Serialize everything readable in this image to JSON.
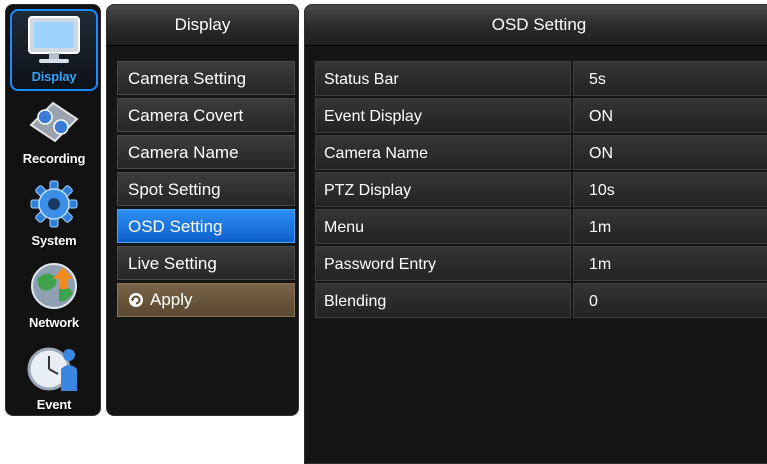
{
  "sidebar": {
    "items": [
      {
        "label": "Display",
        "icon": "monitor-icon",
        "active": true
      },
      {
        "label": "Recording",
        "icon": "film-reel-icon",
        "active": false
      },
      {
        "label": "System",
        "icon": "gear-icon",
        "active": false
      },
      {
        "label": "Network",
        "icon": "globe-icon",
        "active": false
      },
      {
        "label": "Event",
        "icon": "clock-person-icon",
        "active": false
      }
    ]
  },
  "menu": {
    "title": "Display",
    "items": [
      {
        "label": "Camera Setting"
      },
      {
        "label": "Camera Covert"
      },
      {
        "label": "Camera Name"
      },
      {
        "label": "Spot Setting"
      },
      {
        "label": "OSD Setting",
        "selected": true
      },
      {
        "label": "Live Setting"
      }
    ],
    "apply_label": "Apply",
    "apply_icon": "refresh-icon"
  },
  "panel": {
    "title": "OSD Setting",
    "rows": [
      {
        "label": "Status Bar",
        "value": "5s"
      },
      {
        "label": "Event Display",
        "value": "ON"
      },
      {
        "label": "Camera Name",
        "value": "ON"
      },
      {
        "label": "PTZ Display",
        "value": "10s"
      },
      {
        "label": "Menu",
        "value": "1m"
      },
      {
        "label": "Password Entry",
        "value": "1m"
      },
      {
        "label": "Blending",
        "value": "0"
      }
    ]
  },
  "colors": {
    "accent_blue": "#1a8cff",
    "selected_item": "#1a72dc",
    "apply_button": "#6b563c",
    "panel_bg": "#151515"
  }
}
